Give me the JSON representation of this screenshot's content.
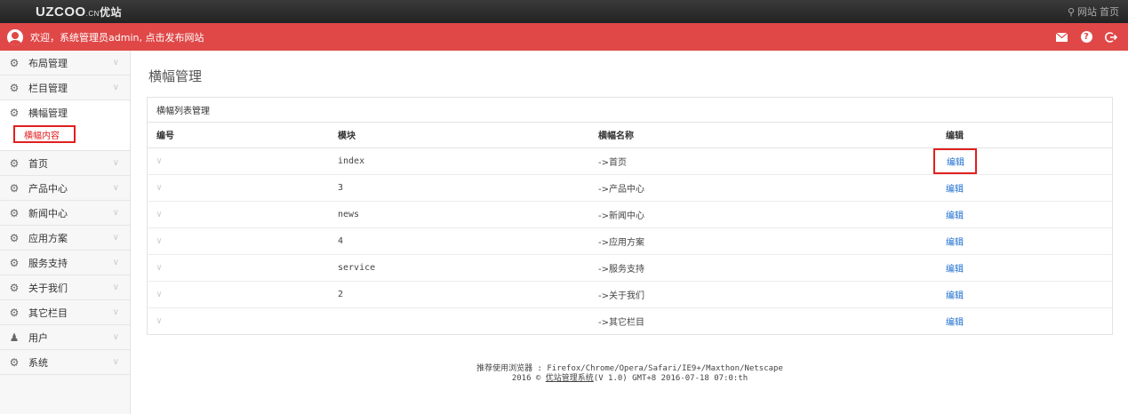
{
  "topbar": {
    "logo_main": "UZCOO",
    "logo_suffix": ".CN",
    "logo_cn": "优站",
    "site_link": "网站",
    "home_link": "首页"
  },
  "redbar": {
    "welcome": "欢迎，系统管理员admin, 点击发布网站"
  },
  "sidebar": {
    "items_top": [
      {
        "label": "布局管理"
      },
      {
        "label": "栏目管理"
      }
    ],
    "open_item": {
      "label": "横幅管理",
      "sub": "横幅内容"
    },
    "items_bottom": [
      {
        "label": "首页"
      },
      {
        "label": "产品中心"
      },
      {
        "label": "新闻中心"
      },
      {
        "label": "应用方案"
      },
      {
        "label": "服务支持"
      },
      {
        "label": "关于我们"
      },
      {
        "label": "其它栏目"
      },
      {
        "label": "用户"
      },
      {
        "label": "系统"
      }
    ]
  },
  "main": {
    "title": "横幅管理",
    "panel_title": "横幅列表管理",
    "columns": [
      "编号",
      "模块",
      "横幅名称",
      "编辑"
    ],
    "rows": [
      {
        "module": "index",
        "name": "->首页",
        "edit": "编辑"
      },
      {
        "module": "3",
        "name": "->产品中心",
        "edit": "编辑"
      },
      {
        "module": "news",
        "name": "->新闻中心",
        "edit": "编辑"
      },
      {
        "module": "4",
        "name": "->应用方案",
        "edit": "编辑"
      },
      {
        "module": "service",
        "name": "->服务支持",
        "edit": "编辑"
      },
      {
        "module": "2",
        "name": "->关于我们",
        "edit": "编辑"
      },
      {
        "module": "",
        "name": "->其它栏目",
        "edit": "编辑"
      }
    ]
  },
  "footer": {
    "line1": "推荐使用浏览器 : Firefox/Chrome/Opera/Safari/IE9+/Maxthon/Netscape",
    "line2_prefix": "2016 © ",
    "line2_link": "优站管理系统",
    "line2_suffix": "(V 1.0) GMT+8 2016-07-18 07:0:th"
  },
  "colors": {
    "redbar": "#e04848",
    "link": "#1e6fd0",
    "highlight": "#e02020"
  }
}
